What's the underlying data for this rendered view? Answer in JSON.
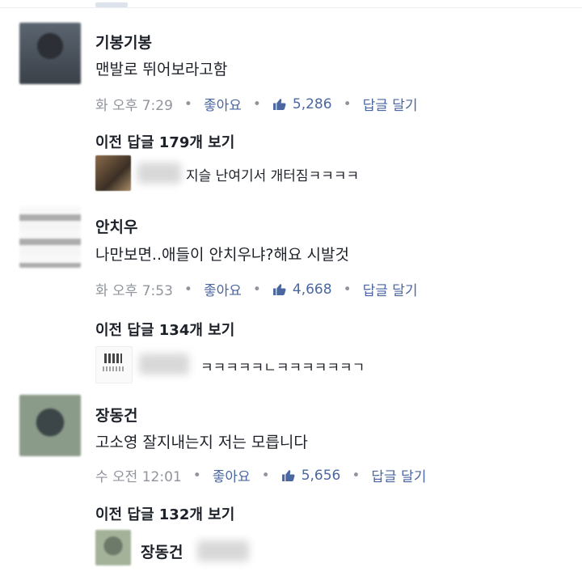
{
  "comments": [
    {
      "author": "기봉기봉",
      "text": "맨발로 뛰어보라고함",
      "time": "화 오후 7:29",
      "like_label": "좋아요",
      "like_count": "5,286",
      "reply_label": "답글 달기",
      "prev_replies": "이전 답글 179개 보기",
      "reply_preview": "지슬 난여기서 개터짐ㅋㅋㅋㅋ"
    },
    {
      "author": "안치우",
      "text": "나만보면..애들이 안치우냐?해요 시발것",
      "time": "화 오후 7:53",
      "like_label": "좋아요",
      "like_count": "4,668",
      "reply_label": "답글 달기",
      "prev_replies": "이전 답글 134개 보기",
      "reply_preview": "ㅋㅋㅋㅋㅋㄴㅋㅋㅋㅋㅋㅋㄱ"
    },
    {
      "author": "장동건",
      "text": "고소영 잘지내는지 저는 모릅니다",
      "time": "수 오전 12:01",
      "like_label": "좋아요",
      "like_count": "5,656",
      "reply_label": "답글 달기",
      "prev_replies": "이전 답글 132개 보기",
      "reply_preview_author": "장동건"
    }
  ],
  "icons": {
    "like": "thumbs-up-icon",
    "dot": "bullet"
  },
  "colors": {
    "link": "#4b67a1",
    "meta": "#90949c",
    "text": "#1d2129"
  }
}
